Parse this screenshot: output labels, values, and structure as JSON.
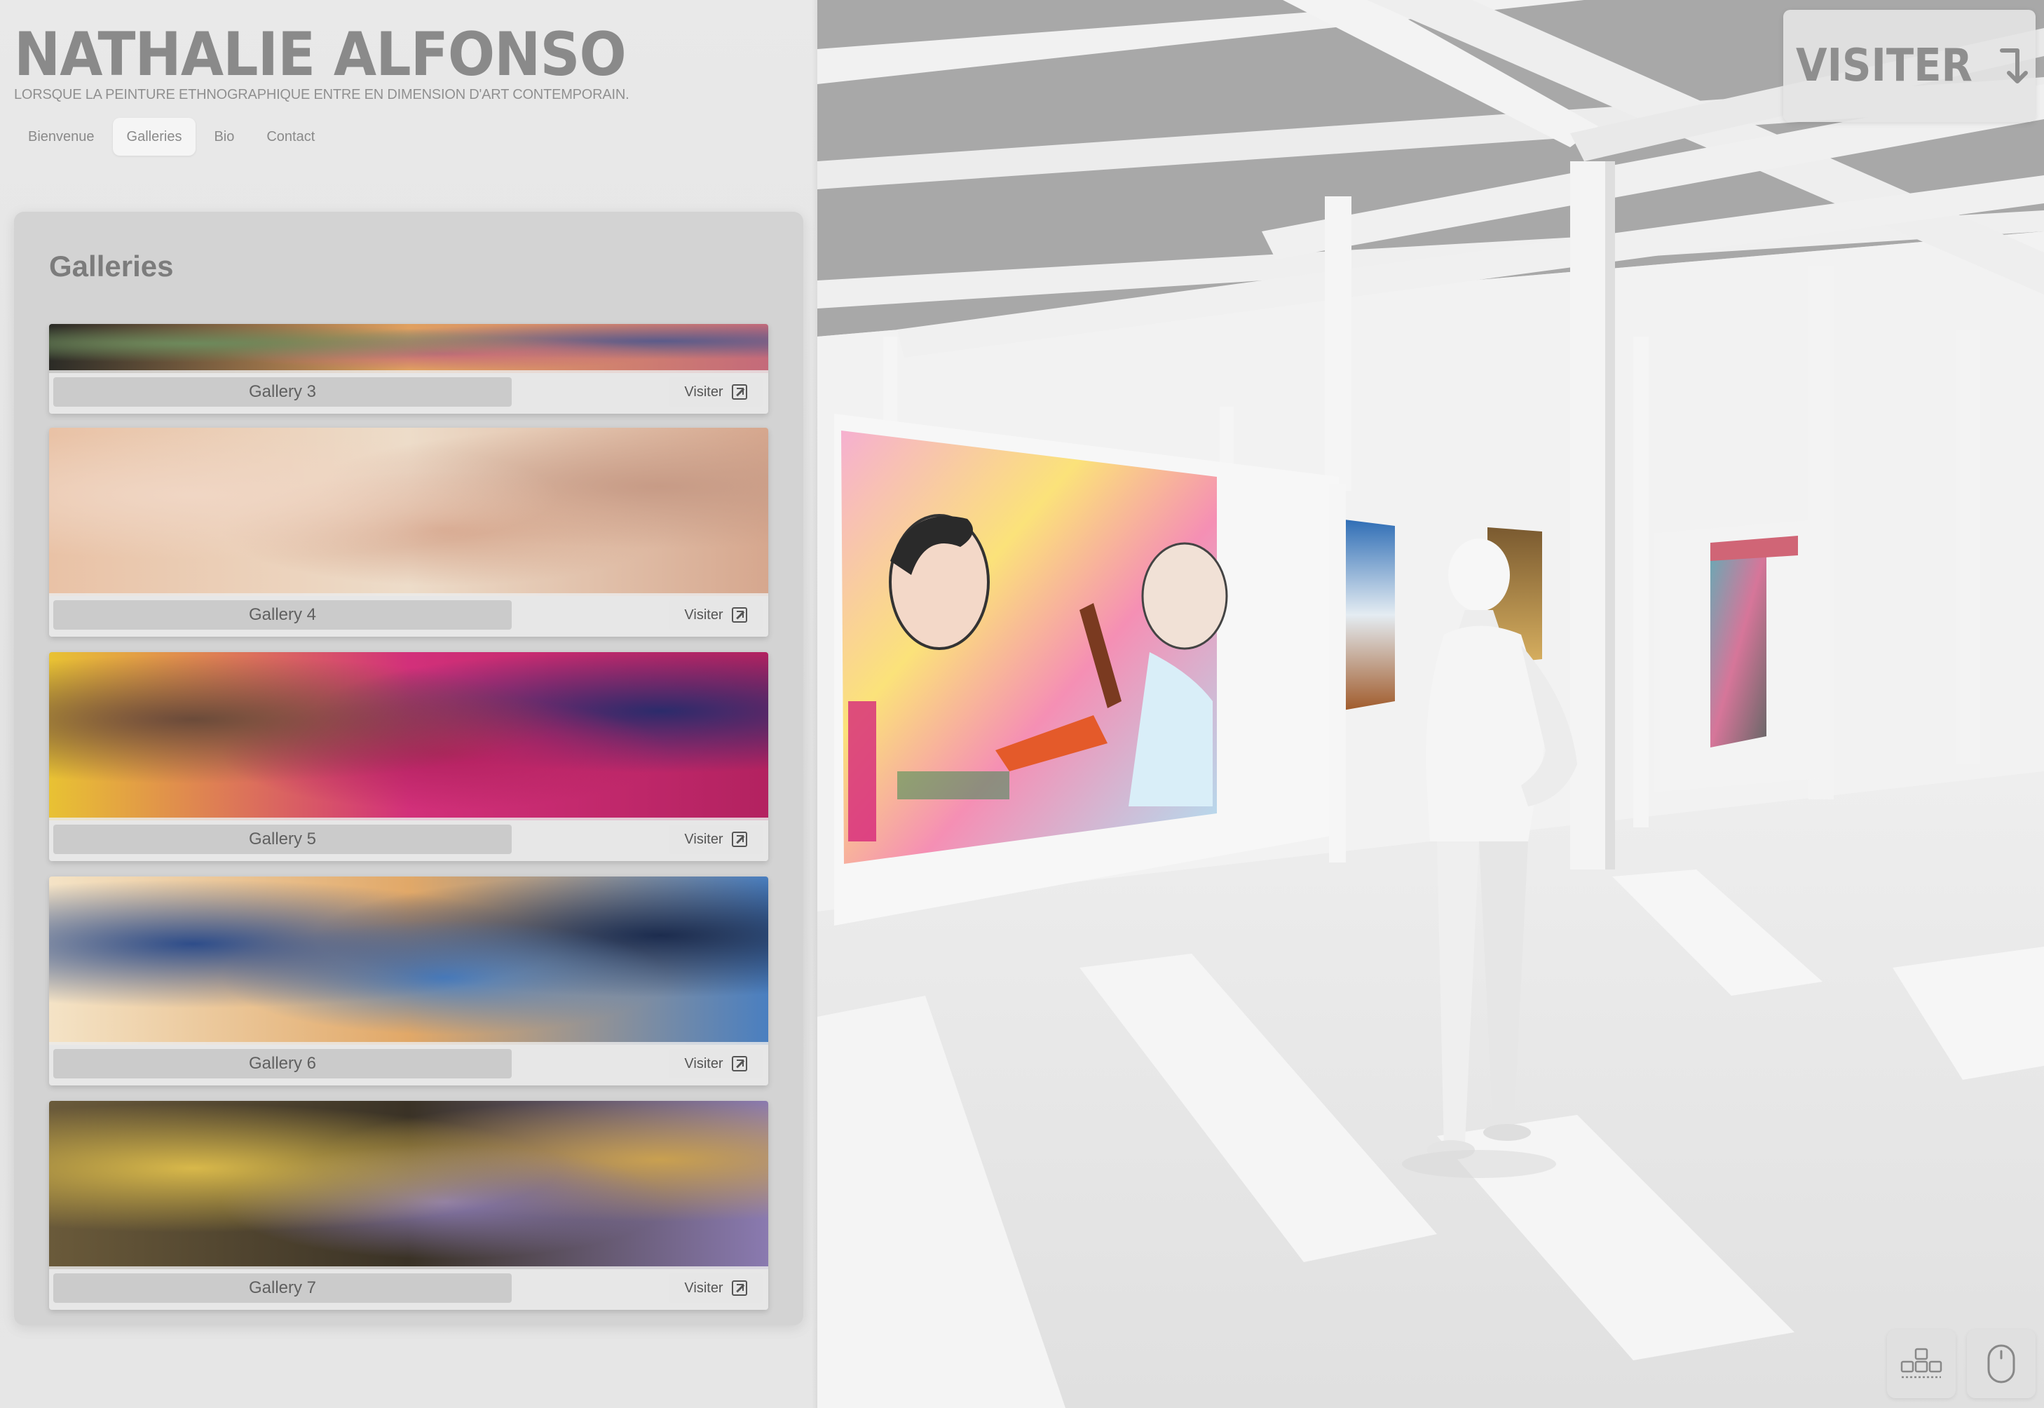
{
  "site": {
    "title": "NATHALIE ALFONSO",
    "tagline": "LORSQUE LA PEINTURE ETHNOGRAPHIQUE ENTRE EN DIMENSION D'ART CONTEMPORAIN."
  },
  "nav": [
    {
      "label": "Bienvenue",
      "active": false
    },
    {
      "label": "Galleries",
      "active": true
    },
    {
      "label": "Bio",
      "active": false
    },
    {
      "label": "Contact",
      "active": false
    }
  ],
  "panel": {
    "heading": "Galleries",
    "galleries": [
      {
        "name": "Gallery 3",
        "visit_label": "Visiter",
        "visit_icon": "external-link-icon",
        "colors": [
          "#2b2b26",
          "#6d8a5c",
          "#c46a7a",
          "#e0a060",
          "#5b5b8a"
        ]
      },
      {
        "name": "Gallery 4",
        "visit_label": "Visiter",
        "visit_icon": "external-link-icon",
        "colors": [
          "#e9c2a6",
          "#f0d6c4",
          "#d6a78e",
          "#eddcc9",
          "#c79b86"
        ]
      },
      {
        "name": "Gallery 5",
        "visit_label": "Visiter",
        "visit_icon": "external-link-icon",
        "colors": [
          "#e8c233",
          "#6b4b3a",
          "#b32260",
          "#d2307a",
          "#2c2b6b"
        ]
      },
      {
        "name": "Gallery 6",
        "visit_label": "Visiter",
        "visit_icon": "external-link-icon",
        "colors": [
          "#f4e3c6",
          "#2e4d8a",
          "#4a7fc0",
          "#e1a868",
          "#1c2c4e"
        ]
      },
      {
        "name": "Gallery 7",
        "visit_label": "Visiter",
        "visit_icon": "external-link-icon",
        "colors": [
          "#6a5a3a",
          "#d8b84a",
          "#8a7ab0",
          "#3a3226",
          "#c9a050"
        ]
      }
    ]
  },
  "scene": {
    "description_colors": {
      "floor": "#e6e6e6",
      "ceiling": "#a9a9a9",
      "walls": "#f3f3f3",
      "beams": "#f0f0f0"
    }
  },
  "controls": {
    "visit_label": "VISITER",
    "visit_icon": "arrow-down-right-icon",
    "keyboard_icon": "keyboard-icon",
    "mouse_icon": "mouse-icon"
  }
}
